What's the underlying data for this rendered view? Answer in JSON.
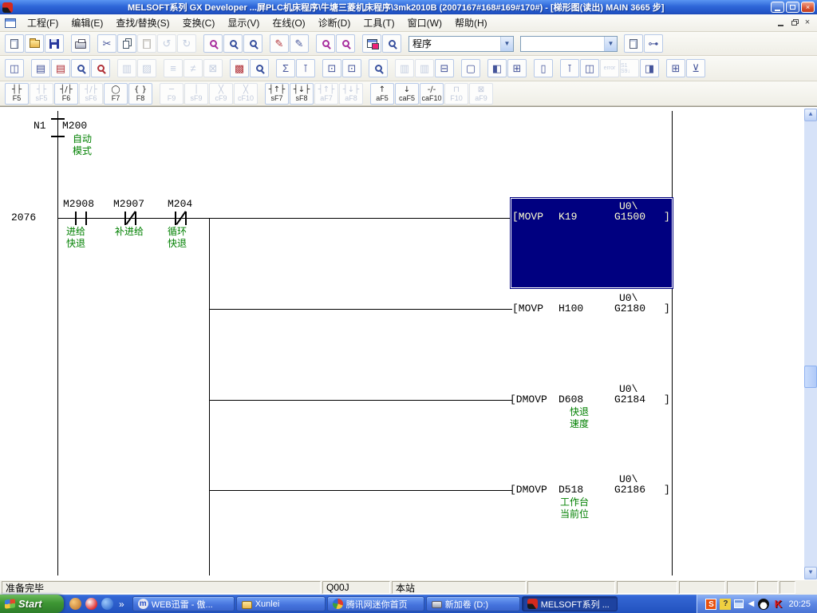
{
  "window": {
    "title": "MELSOFT系列 GX Developer ...屏PLC机床程序\\牛塘三菱机床程序\\3mk2010B    (2007167#168#169#170#) - [梯形图(读出)    MAIN    3665 步]"
  },
  "menu_bar": {
    "items": [
      "工程(F)",
      "编辑(E)",
      "查找/替换(S)",
      "变换(C)",
      "显示(V)",
      "在线(O)",
      "诊断(D)",
      "工具(T)",
      "窗口(W)",
      "帮助(H)"
    ]
  },
  "toolbar_main": {
    "program_combo": {
      "value": "程序"
    },
    "secondary_combo": {
      "value": ""
    },
    "icons": [
      "new",
      "open",
      "save",
      "print",
      "cut",
      "copy",
      "paste",
      "undo",
      "redo",
      "find",
      "find-device",
      "find-instruction",
      "device-test",
      "device-edit",
      "zoom-out",
      "zoom-in",
      "cascade-windows",
      "monitor-find",
      "doc-check",
      "parameter-tree"
    ]
  },
  "toolbar_secondary": {
    "icons": [
      "comment-display",
      "ladder-monitor",
      "ladder-edit",
      "zoom-monitor",
      "zoom-edit",
      "device-monitor-1",
      "device-monitor-2",
      "online-edit-1",
      "online-edit-2",
      "online-edit-3",
      "device-batch",
      "monitor-condition",
      "statement-display",
      "note-display",
      "jump-window-1",
      "jump-window-2",
      "network-monitor",
      "compare-source",
      "compare-dest",
      "program-flow",
      "screen-monitor",
      "tree-view",
      "verify-monitor",
      "doc-view",
      "stack-monitor",
      "window-copy",
      "error-jump",
      "step-run",
      "window-list",
      "grid-view",
      "sort-down"
    ]
  },
  "toolbar_fkeys": {
    "buttons": [
      {
        "symbol": "┤├",
        "label": "F5",
        "enabled": true
      },
      {
        "symbol": "┤├",
        "label": "sF5",
        "enabled": false
      },
      {
        "symbol": "┤/├",
        "label": "F6",
        "enabled": true
      },
      {
        "symbol": "┤/├",
        "label": "sF6",
        "enabled": false
      },
      {
        "symbol": "◯",
        "label": "F7",
        "enabled": true
      },
      {
        "symbol": "{ }",
        "label": "F8",
        "enabled": true
      },
      {
        "symbol": "─",
        "label": "F9",
        "enabled": false
      },
      {
        "symbol": "│",
        "label": "sF9",
        "enabled": false
      },
      {
        "symbol": "╳",
        "label": "cF9",
        "enabled": false
      },
      {
        "symbol": "╳",
        "label": "cF10",
        "enabled": false
      },
      {
        "symbol": "┤↑├",
        "label": "sF7",
        "enabled": true
      },
      {
        "symbol": "┤↓├",
        "label": "sF8",
        "enabled": true
      },
      {
        "symbol": "┤↑├",
        "label": "aF7",
        "enabled": false
      },
      {
        "symbol": "┤↓├",
        "label": "aF8",
        "enabled": false
      },
      {
        "symbol": "↑",
        "label": "aF5",
        "enabled": true
      },
      {
        "symbol": "↓",
        "label": "caF5",
        "enabled": true
      },
      {
        "symbol": "-∕-",
        "label": "caF10",
        "enabled": true
      },
      {
        "symbol": "⊓",
        "label": "F10",
        "enabled": false
      },
      {
        "symbol": "⊠",
        "label": "aF9",
        "enabled": false
      }
    ]
  },
  "ladder": {
    "nest": {
      "label": "N1",
      "device": "M200",
      "comment_line1": "自动",
      "comment_line2": "模式"
    },
    "rung_number": "2076",
    "contacts": [
      {
        "device": "M2908",
        "type": "normally-open",
        "comment_line1": "进给",
        "comment_line2": "快退"
      },
      {
        "device": "M2907",
        "type": "normally-closed",
        "comment_line1": "补进给",
        "comment_line2": ""
      },
      {
        "device": "M204",
        "type": "normally-closed",
        "comment_line1": "循环",
        "comment_line2": "快退"
      }
    ],
    "instructions": [
      {
        "opcode": "[MOVP",
        "source": "K19",
        "dest_line1": "U0\\",
        "dest_line2": "G1500",
        "close": "]",
        "selected": true,
        "comment_line1": "",
        "comment_line2": ""
      },
      {
        "opcode": "[MOVP",
        "source": "H100",
        "dest_line1": "U0\\",
        "dest_line2": "G2180",
        "close": "]",
        "selected": false,
        "comment_line1": "",
        "comment_line2": ""
      },
      {
        "opcode": "[DMOVP",
        "source": "D608",
        "dest_line1": "U0\\",
        "dest_line2": "G2184",
        "close": "]",
        "selected": false,
        "comment_line1": "快退",
        "comment_line2": "速度"
      },
      {
        "opcode": "[DMOVP",
        "source": "D518",
        "dest_line1": "U0\\",
        "dest_line2": "G2186",
        "close": "]",
        "selected": false,
        "comment_line1": "工作台",
        "comment_line2": "当前位"
      }
    ],
    "colors": {
      "selection_bg": "#000080",
      "selection_text": "#FFFFD0",
      "comment_green": "#008000"
    }
  },
  "status_bar": {
    "ready": "准备完毕",
    "cpu_type": "Q00J",
    "station": "本站"
  },
  "taskbar": {
    "start_label": "Start",
    "overflow_chevron": "»",
    "quick_launch": [
      "flashget-icon",
      "qq-icon",
      "media-player-icon"
    ],
    "tasks": [
      {
        "label": "WEB迅雷 - 傲...",
        "active": false
      },
      {
        "label": "Xunlei",
        "active": false
      },
      {
        "label": "腾讯网迷你首页",
        "active": false
      },
      {
        "label": "新加卷 (D:)",
        "active": false
      },
      {
        "label": "MELSOFT系列 ...",
        "active": true
      }
    ],
    "tray_icons": [
      "sogou-icon",
      "help-icon",
      "network-icon",
      "collapse-chevron",
      "qq-tray-icon",
      "kaspersky-icon"
    ],
    "clock": "20:25"
  }
}
